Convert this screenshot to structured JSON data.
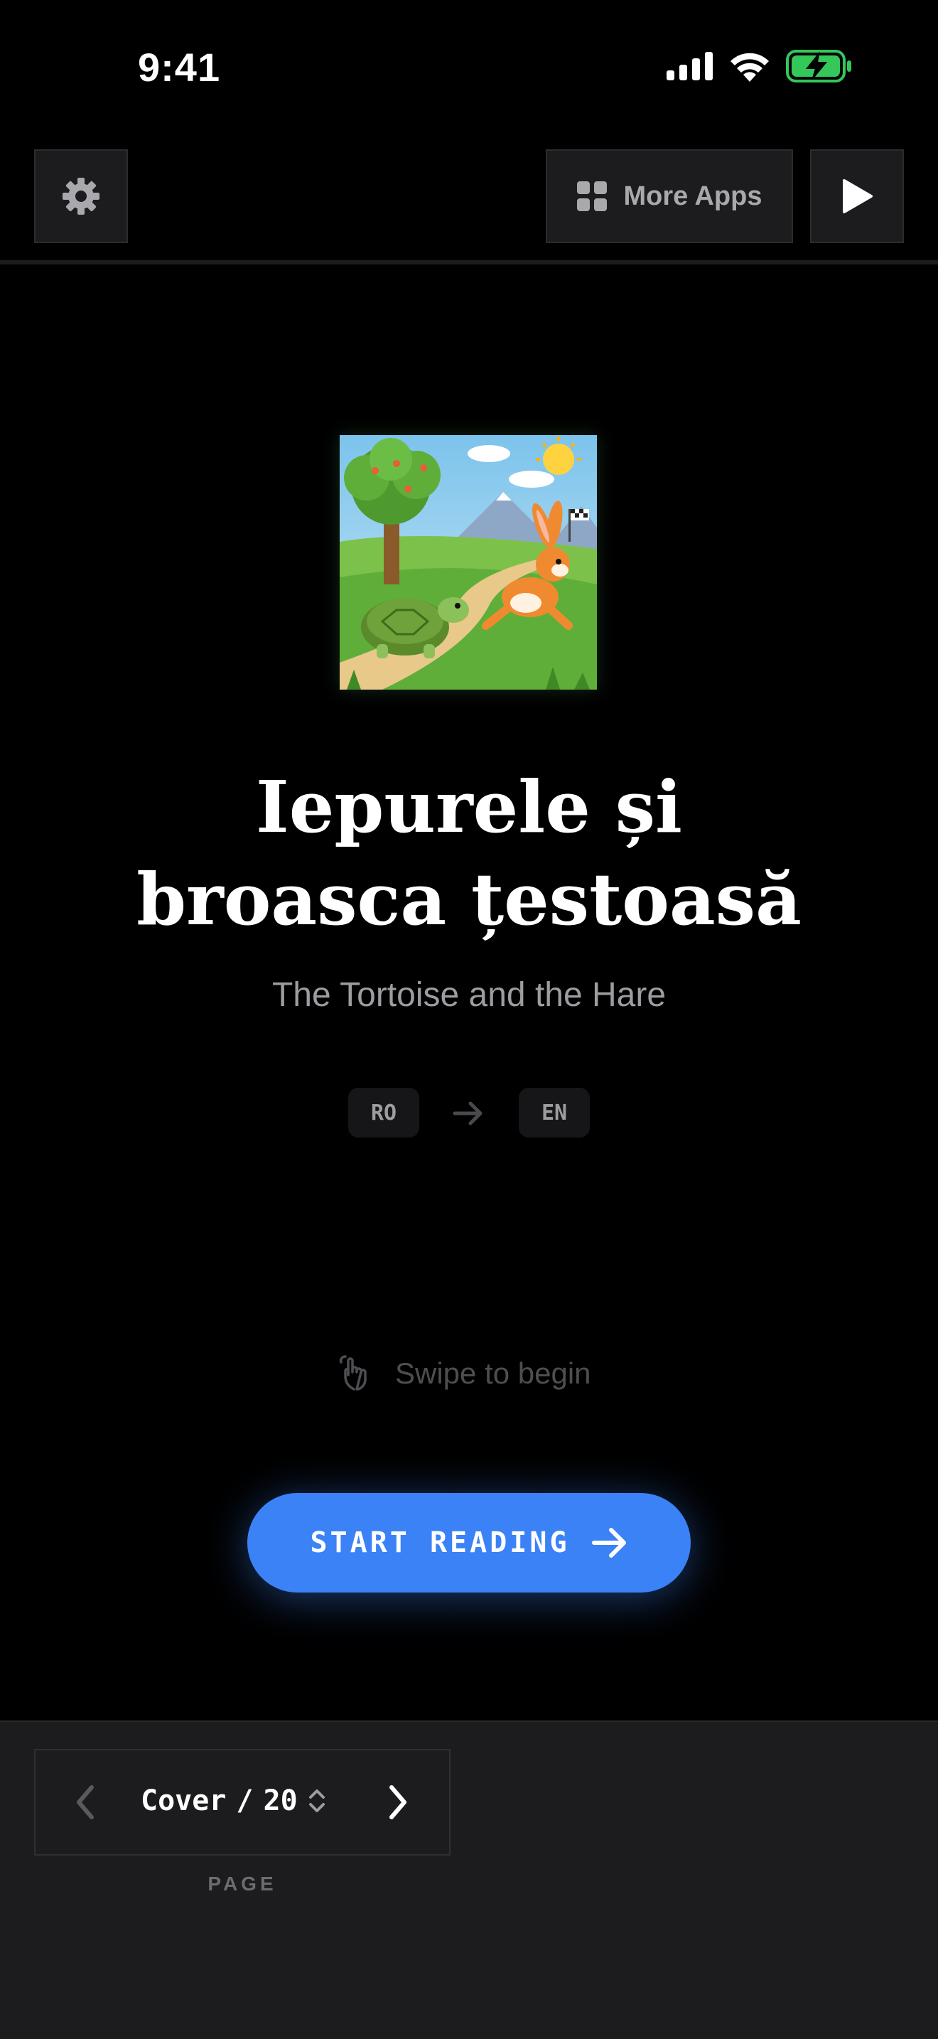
{
  "status_bar": {
    "time": "9:41",
    "icons": [
      "cellular-signal-icon",
      "wifi-icon",
      "battery-charging-icon"
    ]
  },
  "toolbar": {
    "settings_icon": "gear-icon",
    "more_apps_label": "More Apps",
    "more_apps_icon": "grid-icon",
    "play_icon": "play-icon"
  },
  "book": {
    "title_ro_line1": "Iepurele și",
    "title_ro_line2": "broasca țestoasă",
    "title_en": "The Tortoise and the Hare",
    "cover_image": "tortoise-and-hare-illustration"
  },
  "languages": {
    "source": "RO",
    "target": "EN"
  },
  "hint": {
    "text": "Swipe to begin",
    "icon": "hand-swipe-icon"
  },
  "cta": {
    "label": "START READING",
    "icon": "arrow-right-icon"
  },
  "pager": {
    "current": "Cover",
    "separator": "/",
    "total": "20",
    "label": "PAGE"
  },
  "colors": {
    "background": "#000000",
    "panel": "#1c1c1e",
    "accent": "#3b82f6",
    "battery_green": "#34c759",
    "muted_text": "#9c9ca1"
  }
}
